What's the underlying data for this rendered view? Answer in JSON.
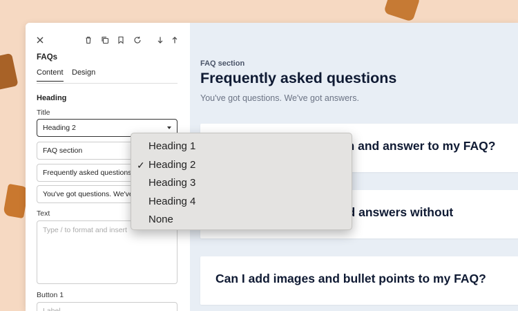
{
  "panel": {
    "title": "FAQs",
    "tabs": [
      {
        "label": "Content"
      },
      {
        "label": "Design"
      }
    ],
    "heading_section": "Heading",
    "title_field_label": "Title",
    "title_select_value": "Heading 2",
    "eyebrow_value": "FAQ section",
    "heading_value": "Frequently asked questions",
    "subheading_value": "You've got questions. We've got answers.",
    "text_label": "Text",
    "text_placeholder": "Type / to format and insert",
    "button1_label": "Button 1",
    "button1_placeholder": "Label"
  },
  "toolbar_icons": [
    "close-icon",
    "trash-icon",
    "duplicate-icon",
    "bookmark-icon",
    "refresh-icon",
    "arrow-down-icon",
    "arrow-up-icon"
  ],
  "preview": {
    "eyebrow": "FAQ section",
    "title": "Frequently asked questions",
    "subtitle": "You've got questions. We've got answers.",
    "faqs": [
      {
        "question": "How do I add a question and answer to my FAQ?"
      },
      {
        "question": "Can I add questions and answers without"
      },
      {
        "question": "Can I add images and bullet points to my FAQ?"
      }
    ]
  },
  "dropdown": {
    "options": [
      {
        "label": "Heading 1",
        "selected": false
      },
      {
        "label": "Heading 2",
        "selected": true
      },
      {
        "label": "Heading 3",
        "selected": false
      },
      {
        "label": "Heading 4",
        "selected": false
      },
      {
        "label": "None",
        "selected": false
      }
    ],
    "check_glyph": "✓"
  },
  "colors": {
    "background": "#f6d9c2",
    "preview_bg": "#e8eef5",
    "heading_text": "#0f1a33",
    "menu_bg": "#e4e3e1"
  }
}
